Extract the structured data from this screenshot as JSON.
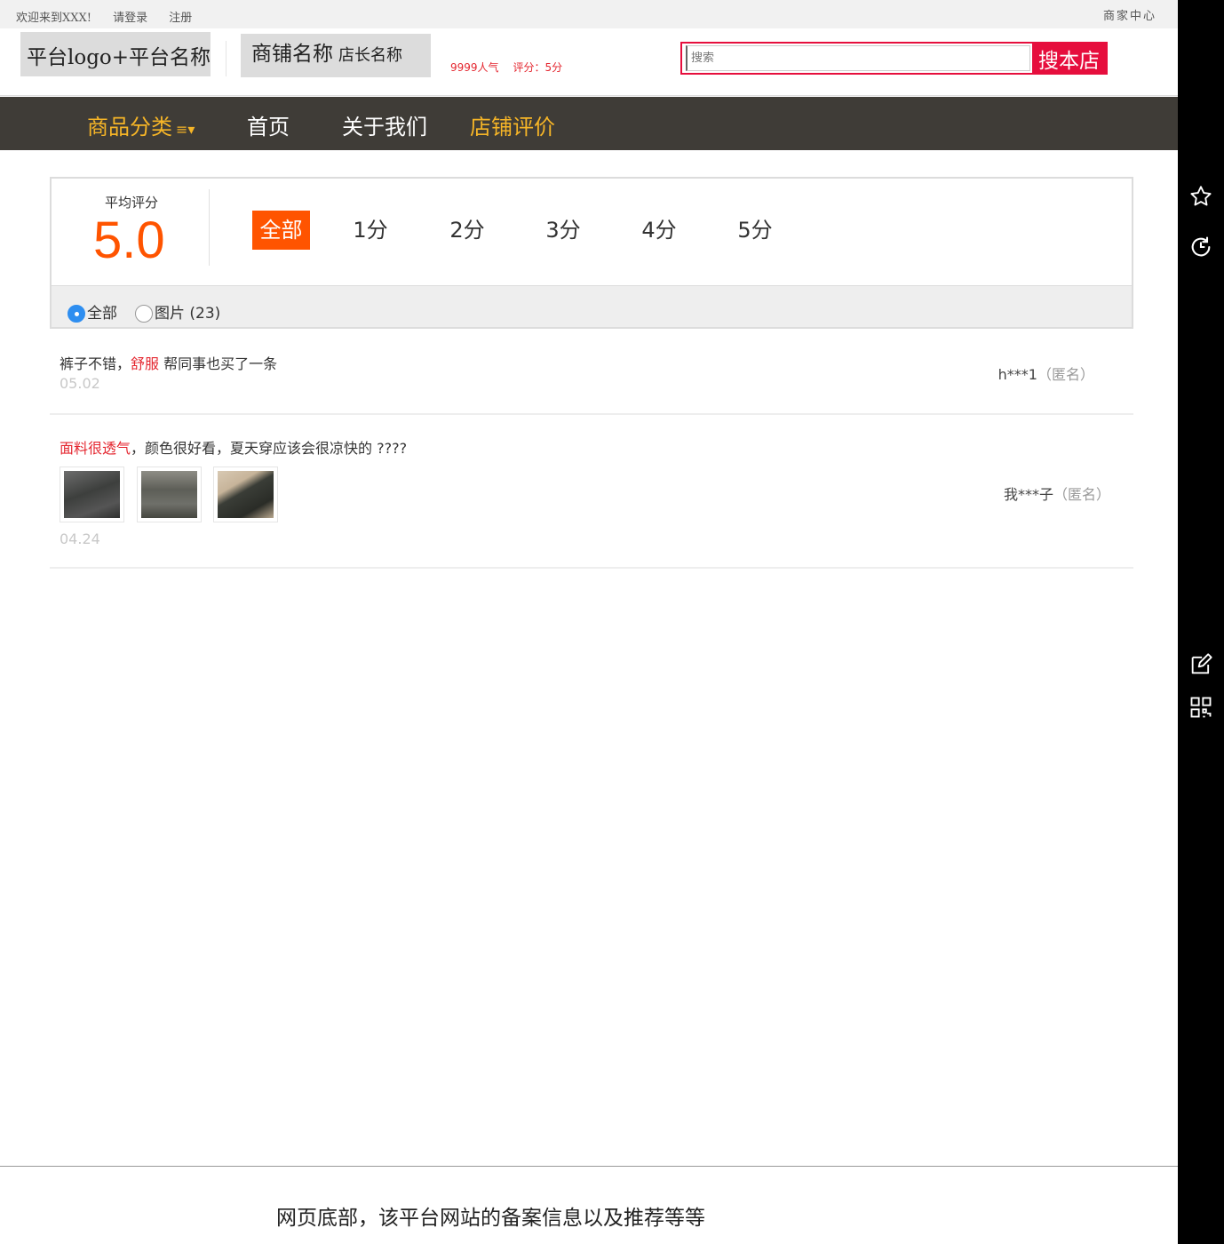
{
  "topbar": {
    "welcome": "欢迎来到XXX!",
    "login": "请登录",
    "register": "注册",
    "merchant_center": "商家中心"
  },
  "header": {
    "platform_logo": "平台logo+平台名称",
    "shop_name": "商铺名称",
    "owner_name": "店长名称",
    "popularity": "9999人气",
    "rating": "评分：5分",
    "search": {
      "placeholder": "搜索",
      "button": "搜本店"
    }
  },
  "nav": {
    "items": [
      {
        "label": "商品分类",
        "highlight": true,
        "has_menu_icon": true
      },
      {
        "label": "首页",
        "highlight": false
      },
      {
        "label": "关于我们",
        "highlight": false
      },
      {
        "label": "店铺评价",
        "highlight": true
      }
    ],
    "menu_icon": "≡▾",
    "background": "#3f3c37",
    "highlight_color": "#f6b527"
  },
  "rating_summary": {
    "label": "平均评分",
    "score": "5.0",
    "filters": [
      "全部",
      "1分",
      "2分",
      "3分",
      "4分",
      "5分"
    ],
    "active_filter": 0,
    "accent": "#ff5400"
  },
  "review_type": {
    "options": [
      {
        "label": "全部",
        "checked": true
      },
      {
        "label": "图片 (23)",
        "checked": false
      }
    ]
  },
  "reviews": [
    {
      "text_before": "裤子不错，",
      "highlight": "舒服",
      "text_after": " 帮同事也买了一条",
      "date": "05.02",
      "user": "h***1",
      "anon": "（匿名）",
      "images": []
    },
    {
      "text_before": "",
      "highlight": "面料很透气",
      "text_after": "，颜色很好看，夏天穿应该会很凉快的 ????",
      "date": "04.24",
      "user": "我***子",
      "anon": "（匿名）",
      "images": [
        "review-photo-1",
        "review-photo-2",
        "review-photo-3"
      ]
    }
  ],
  "footer": {
    "text": "网页底部，该平台网站的备案信息以及推荐等等"
  },
  "sidebar": {
    "icons": [
      "star-icon",
      "refresh-icon",
      "edit-icon",
      "qrcode-icon"
    ]
  }
}
